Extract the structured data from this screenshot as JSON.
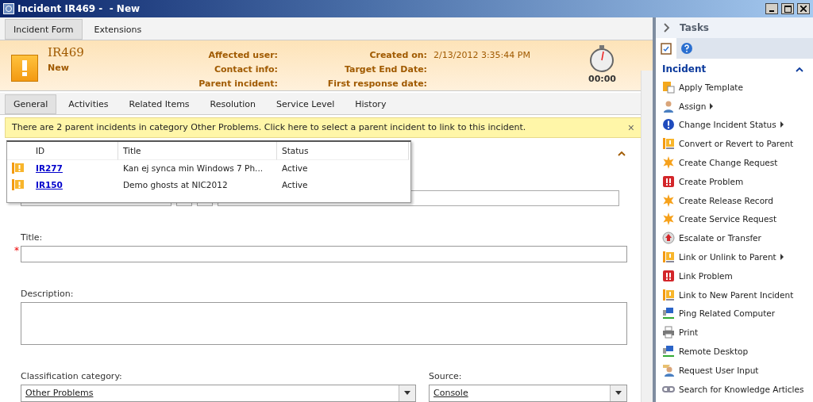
{
  "window": {
    "title": "Incident IR469 -  - New"
  },
  "form_tabs": [
    {
      "label": "Incident Form",
      "selected": true
    },
    {
      "label": "Extensions",
      "selected": false
    }
  ],
  "header": {
    "id": "IR469",
    "status": "New",
    "left_fields": [
      {
        "label": "Affected user:"
      },
      {
        "label": "Contact info:"
      },
      {
        "label": "Parent incident:"
      }
    ],
    "right_fields": [
      {
        "label": "Created on:",
        "value": "2/13/2012 3:35:44 PM"
      },
      {
        "label": "Target End Date:"
      },
      {
        "label": "First response date:"
      }
    ],
    "timer": "00:00"
  },
  "section_tabs": [
    {
      "label": "General",
      "selected": true
    },
    {
      "label": "Activities",
      "selected": false
    },
    {
      "label": "Related Items",
      "selected": false
    },
    {
      "label": "Resolution",
      "selected": false
    },
    {
      "label": "Service Level",
      "selected": false
    },
    {
      "label": "History",
      "selected": false
    }
  ],
  "banner": {
    "message": "There are 2 parent incidents in category Other Problems. Click here to select a parent incident to link to this incident.",
    "close": "×"
  },
  "parent_popup": {
    "columns": [
      "ID",
      "Title",
      "Status"
    ],
    "rows": [
      {
        "id": "IR277",
        "title": "Kan ej synca min Windows 7 Ph...",
        "status": "Active"
      },
      {
        "id": "IR150",
        "title": "Demo ghosts at NIC2012",
        "status": "Active"
      }
    ]
  },
  "form": {
    "title": {
      "label": "Title:",
      "required_mark": "*"
    },
    "description": {
      "label": "Description:"
    },
    "classification": {
      "label": "Classification category:",
      "value": "Other Problems"
    },
    "source": {
      "label": "Source:",
      "value": "Console"
    }
  },
  "tasks": {
    "title": "Tasks",
    "section": "Incident",
    "items": [
      {
        "label": "Apply Template",
        "kind": "template",
        "submenu": false
      },
      {
        "label": "Assign",
        "kind": "user",
        "submenu": true
      },
      {
        "label": "Change Incident Status",
        "kind": "status",
        "submenu": true
      },
      {
        "label": "Convert or Revert to Parent",
        "kind": "parent",
        "submenu": false
      },
      {
        "label": "Create Change Request",
        "kind": "star",
        "submenu": false
      },
      {
        "label": "Create Problem",
        "kind": "problem",
        "submenu": false
      },
      {
        "label": "Create Release Record",
        "kind": "star",
        "submenu": false
      },
      {
        "label": "Create Service Request",
        "kind": "star",
        "submenu": false
      },
      {
        "label": "Escalate or Transfer",
        "kind": "escalate",
        "submenu": false
      },
      {
        "label": "Link or Unlink to Parent",
        "kind": "parent",
        "submenu": true
      },
      {
        "label": "Link Problem",
        "kind": "problem",
        "submenu": false
      },
      {
        "label": "Link to New Parent Incident",
        "kind": "parent",
        "submenu": false
      },
      {
        "label": "Ping Related Computer",
        "kind": "computer",
        "submenu": false
      },
      {
        "label": "Print",
        "kind": "print",
        "submenu": false
      },
      {
        "label": "Remote Desktop",
        "kind": "computer",
        "submenu": false
      },
      {
        "label": "Request User Input",
        "kind": "input",
        "submenu": false
      },
      {
        "label": "Search for Knowledge Articles",
        "kind": "link",
        "submenu": false
      }
    ]
  }
}
